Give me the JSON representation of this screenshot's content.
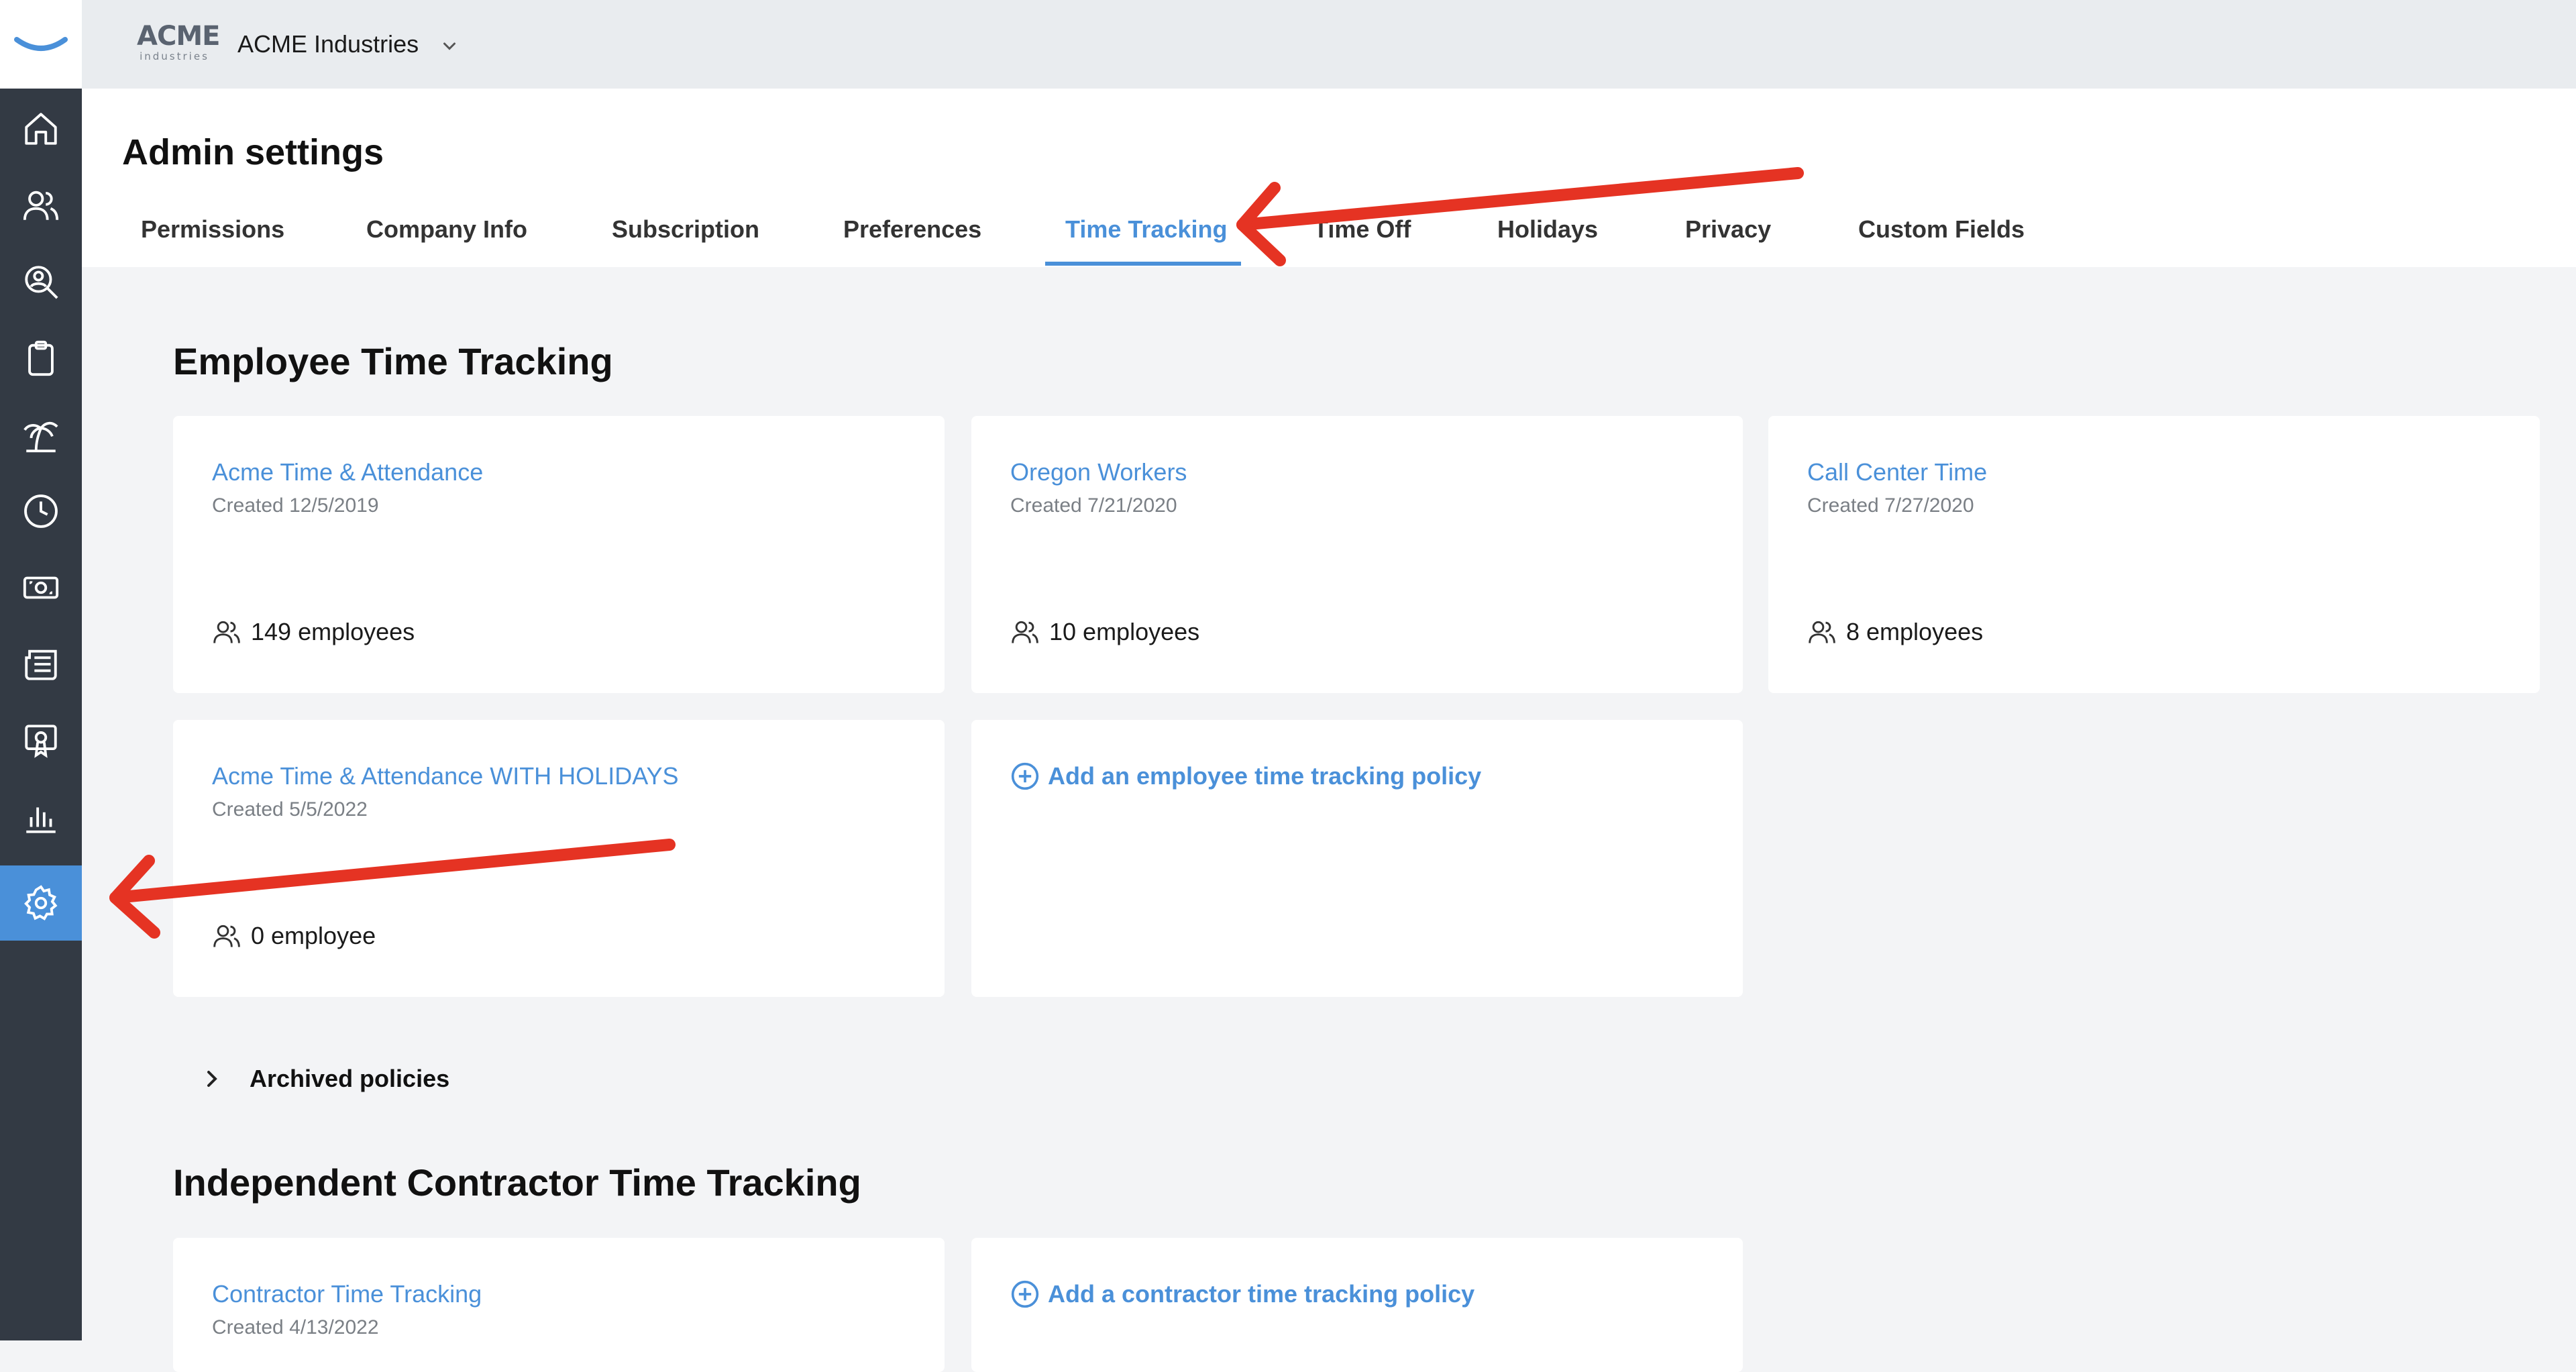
{
  "colors": {
    "accent": "#4a90d9",
    "sidebar": "#333a44",
    "annotation_arrow": "#e53323"
  },
  "company": {
    "logo_big": "ACME",
    "logo_small": "industries",
    "name": "ACME Industries",
    "switcher_icon": "chevron-down-icon"
  },
  "sidebar": {
    "items": [
      {
        "icon": "home-icon"
      },
      {
        "icon": "people-icon"
      },
      {
        "icon": "search-person-icon"
      },
      {
        "icon": "clipboard-icon"
      },
      {
        "icon": "palm-tree-icon"
      },
      {
        "icon": "clock-icon"
      },
      {
        "icon": "money-icon"
      },
      {
        "icon": "newspaper-icon"
      },
      {
        "icon": "certificate-icon"
      },
      {
        "icon": "bar-chart-icon"
      },
      {
        "icon": "gear-icon",
        "active": true
      }
    ]
  },
  "header": {
    "title": "Admin settings",
    "tabs": [
      {
        "label": "Permissions"
      },
      {
        "label": "Company Info"
      },
      {
        "label": "Subscription"
      },
      {
        "label": "Preferences"
      },
      {
        "label": "Time Tracking",
        "active": true
      },
      {
        "label": "Time Off"
      },
      {
        "label": "Holidays"
      },
      {
        "label": "Privacy"
      },
      {
        "label": "Custom Fields"
      }
    ]
  },
  "employee_section": {
    "title": "Employee Time Tracking",
    "policies": [
      {
        "name": "Acme Time & Attendance",
        "created": "Created 12/5/2019",
        "count": "149 employees"
      },
      {
        "name": "Oregon Workers",
        "created": "Created 7/21/2020",
        "count": "10 employees"
      },
      {
        "name": "Call Center Time",
        "created": "Created 7/27/2020",
        "count": "8 employees"
      },
      {
        "name": "Acme Time & Attendance WITH HOLIDAYS",
        "created": "Created 5/5/2022",
        "count": "0 employee"
      }
    ],
    "add_label": "Add an employee time tracking policy",
    "archived_label": "Archived policies"
  },
  "contractor_section": {
    "title": "Independent Contractor Time Tracking",
    "policies": [
      {
        "name": "Contractor Time Tracking",
        "created": "Created 4/13/2022"
      }
    ],
    "add_label": "Add a contractor time tracking policy"
  }
}
